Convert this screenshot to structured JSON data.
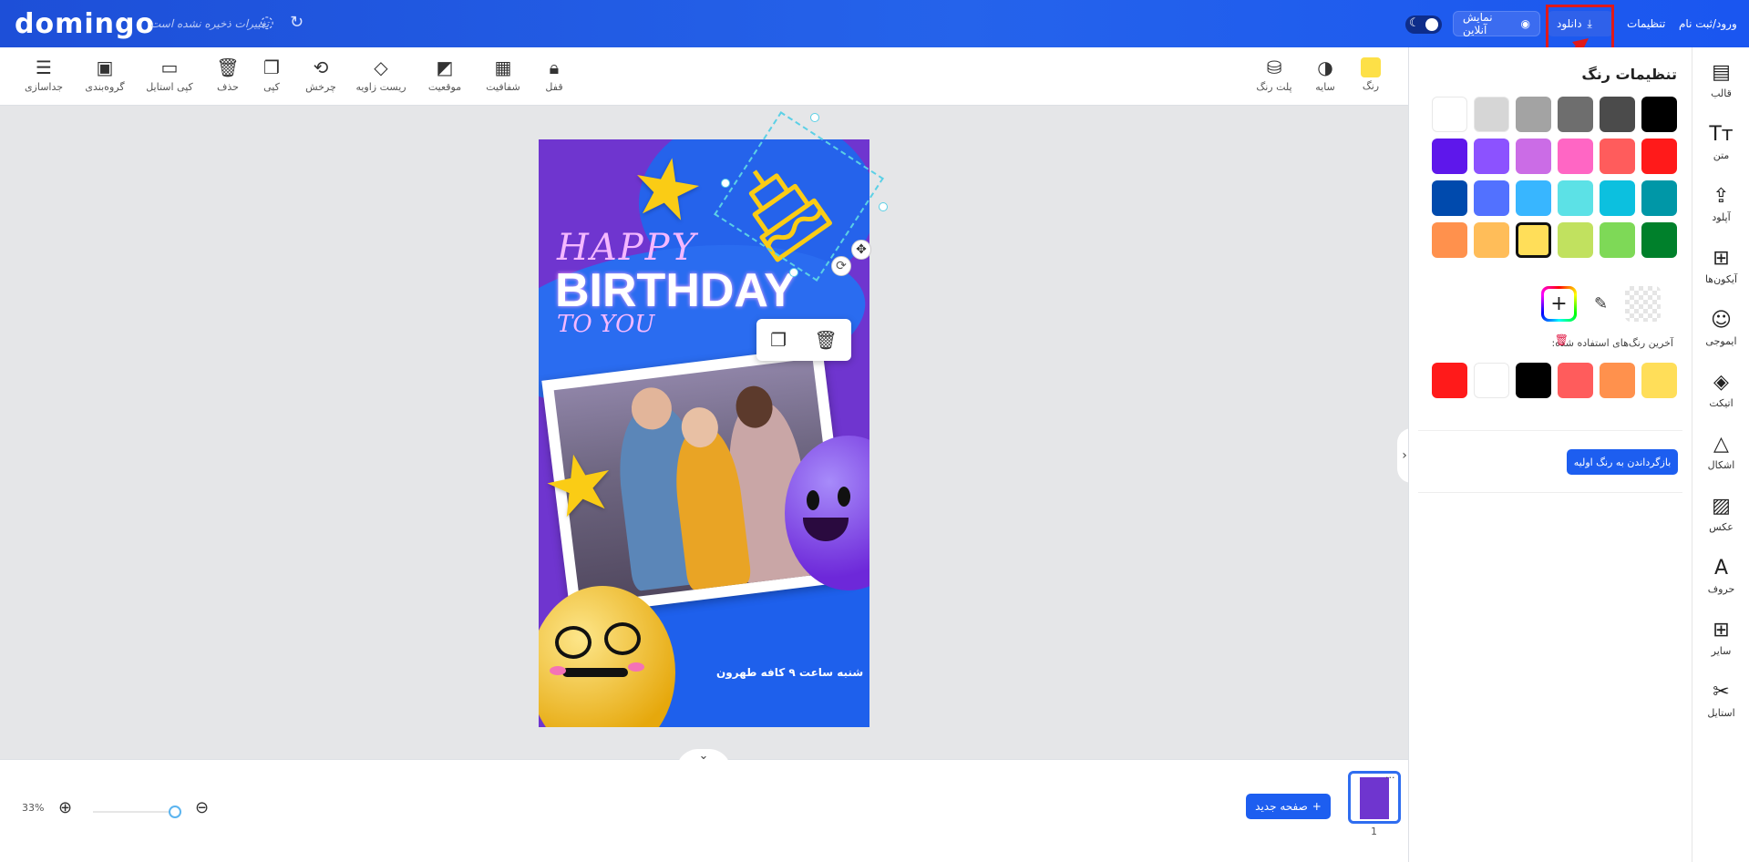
{
  "header": {
    "logo": "domingo",
    "save_status": "تغییرات ذخیره نشده است",
    "online_preview": "نمایش آنلاین",
    "download": "دانلود",
    "settings": "تنظیمات",
    "login": "ورود/ثبت نام"
  },
  "toolbar": {
    "right_tools": [
      {
        "label": "رنگ"
      },
      {
        "label": "سایه"
      },
      {
        "label": "پلت رنگ"
      }
    ],
    "left_tools": [
      {
        "label": "قفل"
      },
      {
        "label": "شفافیت"
      },
      {
        "label": "موقعیت"
      },
      {
        "label": "ریست زاویه"
      },
      {
        "label": "چرخش"
      },
      {
        "label": "کپی"
      },
      {
        "label": "حذف"
      },
      {
        "label": "کپی استایل"
      },
      {
        "label": "گروه‌بندی"
      },
      {
        "label": "جداسازی"
      }
    ]
  },
  "design": {
    "line1": "HAPPY",
    "line2": "BIRTHDAY",
    "line3": "TO YOU",
    "event": "شنبه ساعت ۹ کافه طهرون"
  },
  "bottom": {
    "zoom": "33%",
    "new_page": "صفحه جدید",
    "page_number": "1"
  },
  "color_panel": {
    "title": "تنظیمات رنگ",
    "palette": [
      [
        "#000000",
        "#4b4b4b",
        "#6e6e6e",
        "#a3a3a3",
        "#d6d6d6",
        "#ffffff"
      ],
      [
        "#ff1a1a",
        "#ff5c5c",
        "#ff66c4",
        "#cb6ce6",
        "#8c52ff",
        "#5e17eb"
      ],
      [
        "#0097a7",
        "#0cc0df",
        "#5ce1e6",
        "#38b6ff",
        "#5271ff",
        "#004aad"
      ],
      [
        "#00802b",
        "#7ed957",
        "#c1e15f",
        "#ffde59",
        "#ffbd59",
        "#ff914d"
      ]
    ],
    "selected_color": "#ffde59",
    "recent_label": "آخرین رنگ‌های استفاده شده:",
    "recent": [
      "#ffde59",
      "#ff914d",
      "#ff5c5c",
      "#000000",
      "#ffffff",
      "#ff1a1a"
    ],
    "reset": "بازگرداندن به رنگ اولیه"
  },
  "side_nav": [
    {
      "label": "قالب",
      "icon": "template-icon"
    },
    {
      "label": "متن",
      "icon": "text-icon"
    },
    {
      "label": "آپلود",
      "icon": "upload-icon"
    },
    {
      "label": "آیکون‌ها",
      "icon": "grid-icon"
    },
    {
      "label": "ایموجی",
      "icon": "emoji-icon"
    },
    {
      "label": "اتیکت",
      "icon": "tag-icon"
    },
    {
      "label": "اشکال",
      "icon": "shapes-icon"
    },
    {
      "label": "عکس",
      "icon": "image-icon"
    },
    {
      "label": "حروف",
      "icon": "letter-icon"
    },
    {
      "label": "سایر",
      "icon": "more-icon"
    },
    {
      "label": "استایل",
      "icon": "style-icon"
    }
  ]
}
